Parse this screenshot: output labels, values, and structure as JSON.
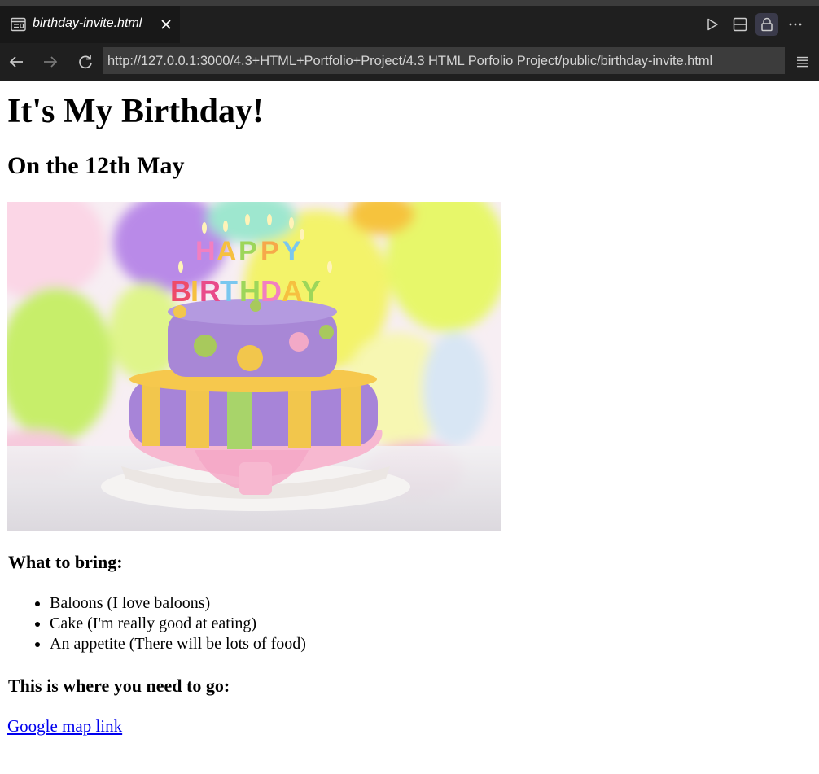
{
  "editor_tab": {
    "title": "birthday-invite.html",
    "icon": "preview-icon",
    "close_icon": "close-icon"
  },
  "toolbar": {
    "run_icon": "play-icon",
    "split_icon": "split-editor-icon",
    "lock_icon": "lock-icon",
    "more_icon": "more-icon"
  },
  "browser": {
    "back_icon": "arrow-left-icon",
    "forward_icon": "arrow-right-icon",
    "reload_icon": "reload-icon",
    "url": "http://127.0.0.1:3000/4.3+HTML+Portfolio+Project/4.3 HTML Porfolio Project/public/birthday-invite.html",
    "menu_icon": "menu-icon"
  },
  "page": {
    "heading": "It's My Birthday!",
    "date_heading": "On the 12th May",
    "image_subject": "birthday-cake",
    "what_to_bring_heading": "What to bring:",
    "items": [
      "Baloons (I love baloons)",
      "Cake (I'm really good at eating)",
      "An appetite (There will be lots of food)"
    ],
    "where_heading": "This is where you need to go:",
    "map_link": "Google map link"
  },
  "colors": {
    "chrome_dark": "#1f1f1f",
    "tab_active": "#181818",
    "url_bg": "#3c3c3c",
    "link": "#0000ee"
  }
}
